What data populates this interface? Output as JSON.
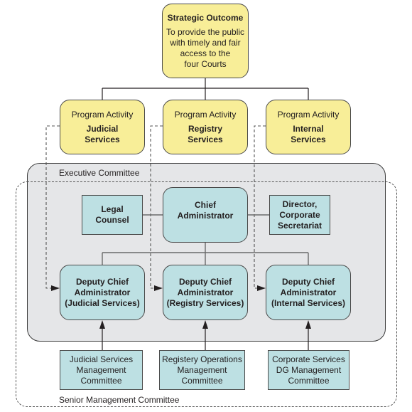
{
  "strategic_outcome": {
    "title": "Strategic Outcome",
    "description_lines": [
      "To provide the public",
      "with timely and fair",
      "access to the",
      "four Courts"
    ]
  },
  "program_activities": [
    {
      "header": "Program Activity",
      "name_lines": [
        "Judicial",
        "Services"
      ]
    },
    {
      "header": "Program Activity",
      "name_lines": [
        "Registry",
        "Services"
      ]
    },
    {
      "header": "Program Activity",
      "name_lines": [
        "Internal",
        "Services"
      ]
    }
  ],
  "executive_committee": {
    "label": "Executive Committee",
    "legal_counsel": [
      "Legal",
      "Counsel"
    ],
    "chief_administrator": [
      "Chief",
      "Administrator"
    ],
    "director": [
      "Director,",
      "Corporate",
      "Secretariat"
    ],
    "deputies": [
      [
        "Deputy Chief",
        "Administrator",
        "(Judicial Services)"
      ],
      [
        "Deputy Chief",
        "Administrator",
        "(Registry Services)"
      ],
      [
        "Deputy Chief",
        "Administrator",
        "(Internal Services)"
      ]
    ]
  },
  "senior_management_committee": {
    "label": "Senior Management Committee",
    "committees": [
      [
        "Judicial Services",
        "Management",
        "Committee"
      ],
      [
        "Registery Operations",
        "Management",
        "Committee"
      ],
      [
        "Corporate Services",
        "DG Management",
        "Committee"
      ]
    ]
  },
  "colors": {
    "program_fill": "#f8ee98",
    "admin_fill": "#bde0e3",
    "executive_fill": "#e5e6e8"
  }
}
